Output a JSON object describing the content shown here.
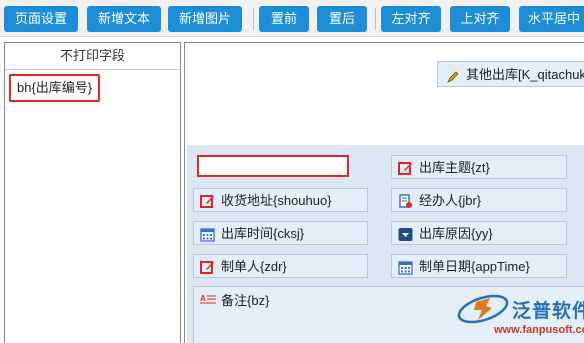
{
  "toolbar": {
    "buttons": [
      "页面设置",
      "新增文本",
      "新增图片",
      "置前",
      "置后",
      "左对齐",
      "上对齐",
      "水平居中"
    ]
  },
  "left_panel": {
    "header": "不打印字段",
    "items": [
      "bh{出库编号}"
    ]
  },
  "canvas": {
    "header_field": "其他出库[K_qitachuku",
    "fields": [
      {
        "label": "出库主题{zt}",
        "icon": "edit-icon"
      },
      {
        "label": "收货地址{shouhuo}",
        "icon": "edit-icon"
      },
      {
        "label": "经办人{jbr}",
        "icon": "person-list-icon"
      },
      {
        "label": "出库时间{cksj}",
        "icon": "calendar-icon"
      },
      {
        "label": "出库原因{yy}",
        "icon": "dropdown-icon"
      },
      {
        "label": "制单人{zdr}",
        "icon": "edit-icon"
      },
      {
        "label": "制单日期{appTime}",
        "icon": "calendar-icon"
      }
    ],
    "remark_field": {
      "label": "备注{bz}",
      "icon": "textarea-icon"
    }
  },
  "logo": {
    "text": "泛普软件",
    "url": "www.fanpusoft.com"
  },
  "colors": {
    "toolbar_button": "#1c8dd6",
    "field_background": "#e4eef7",
    "band_background": "#dbe8f3",
    "highlight_border": "#e0262a",
    "edit_icon": "#e0262a",
    "calendar_icon": "#3a6fd1"
  }
}
